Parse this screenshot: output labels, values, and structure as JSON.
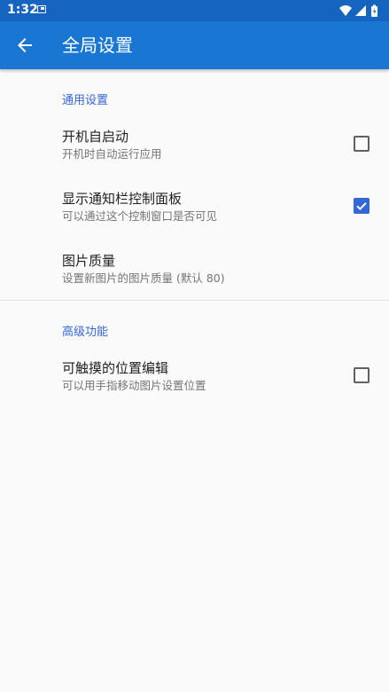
{
  "status_bar": {
    "time": "1:32",
    "icons": [
      "notification-icon",
      "wifi-icon",
      "signal-icon",
      "battery-icon"
    ]
  },
  "app_bar": {
    "title": "全局设置",
    "back_icon": "arrow-back-icon"
  },
  "sections": [
    {
      "header": "通用设置",
      "items": [
        {
          "title": "开机自启动",
          "summary": "开机时自动运行应用",
          "checkbox": true,
          "checked": false
        },
        {
          "title": "显示通知栏控制面板",
          "summary": "可以通过这个控制窗口是否可见",
          "checkbox": true,
          "checked": true
        },
        {
          "title": "图片质量",
          "summary": "设置新图片的图片质量 (默认 80)",
          "checkbox": false
        }
      ]
    },
    {
      "header": "高级功能",
      "items": [
        {
          "title": "可触摸的位置编辑",
          "summary": "可以用手指移动图片设置位置",
          "checkbox": true,
          "checked": false
        }
      ]
    }
  ],
  "colors": {
    "status_bar": "#1565c0",
    "app_bar": "#1976d2",
    "accent": "#3367d6",
    "background": "#fafafa"
  }
}
